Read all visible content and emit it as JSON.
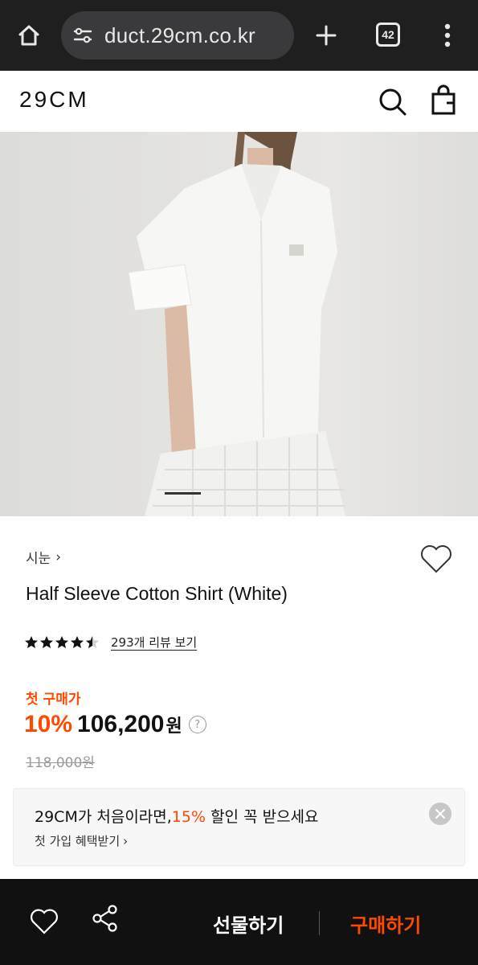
{
  "browser": {
    "url": "duct.29cm.co.kr",
    "tab_count": "42"
  },
  "header": {
    "logo": "29CM"
  },
  "product": {
    "brand": "시눈",
    "brand_chevron": "›",
    "title": "Half Sleeve Cotton Shirt (White)",
    "rating": 4.5,
    "rating_max": 5,
    "review_link": "293개 리뷰 보기",
    "price_label": "첫 구매가",
    "discount": "10%",
    "price": "106,200",
    "currency": "원",
    "help": "?",
    "original_price": "118,000원"
  },
  "promo": {
    "title_prefix": "29CM가 처음이라면,",
    "title_highlight": "15%",
    "title_suffix": " 할인 꼭 받으세요",
    "subtitle": "첫 가입 혜택받기",
    "subtitle_chevron": "›"
  },
  "bottom_bar": {
    "gift_label": "선물하기",
    "buy_label": "구매하기"
  },
  "colors": {
    "accent": "#ff4800",
    "browser_bg": "#1f1f1f",
    "bottom_bar_bg": "#111111"
  }
}
